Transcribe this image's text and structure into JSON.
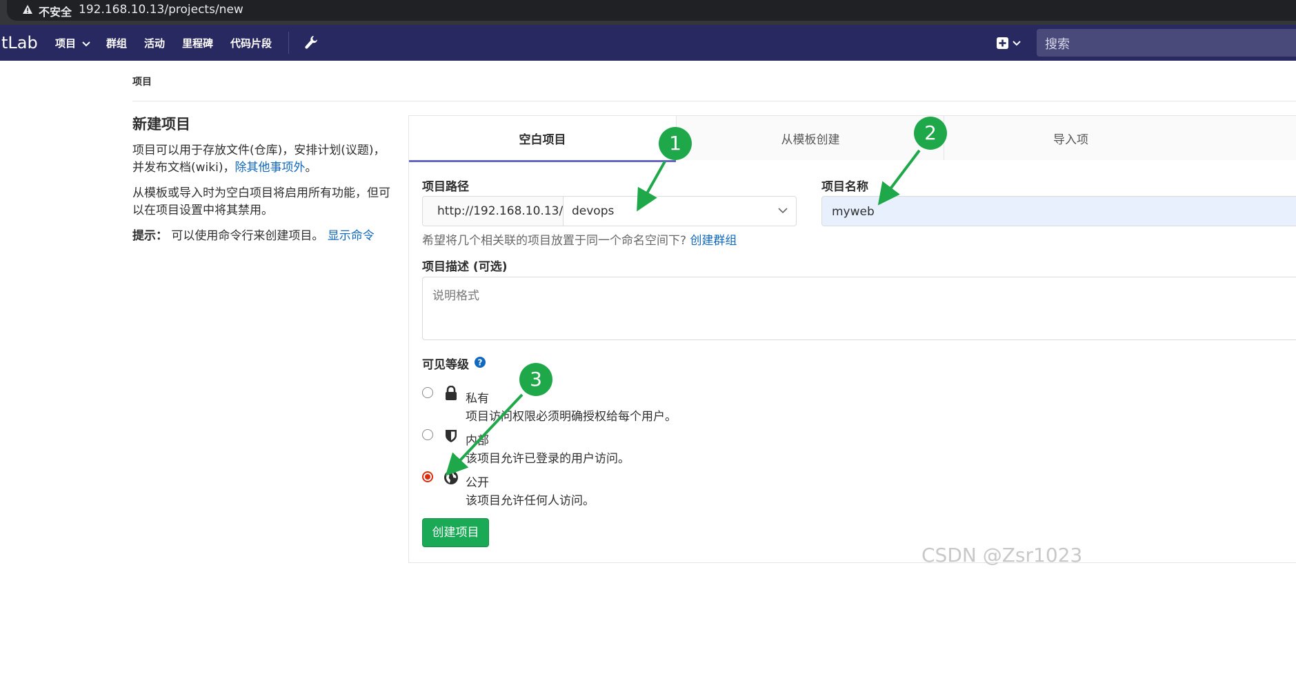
{
  "browser": {
    "insecure_label": "不安全",
    "url": "192.168.10.13/projects/new"
  },
  "nav": {
    "brand": "tLab",
    "items": [
      "项目",
      "群组",
      "活动",
      "里程碑",
      "代码片段"
    ],
    "search_placeholder": "搜索"
  },
  "breadcrumb": "项目",
  "left": {
    "title": "新建项目",
    "desc1": "项目可以用于存放文件(仓库)，安排计划(议题)，并发布文档(wiki)，",
    "desc1_link": "除其他事项外",
    "desc1_end": "。",
    "desc2": "从模板或导入时为空白项目将启用所有功能，但可以在项目设置中将其禁用。",
    "tip_label": "提示：",
    "tip_text": "可以使用命令行来创建项目。",
    "tip_link": "显示命令"
  },
  "tabs": [
    "空白项目",
    "从模板创建",
    "导入项"
  ],
  "form": {
    "path_label": "项目路径",
    "path_prefix": "http://192.168.10.13/",
    "namespace": "devops",
    "name_label": "项目名称",
    "name_value": "myweb",
    "hint_text": "希望将几个相关联的项目放置于同一个命名空间下?",
    "hint_link": "创建群组",
    "desc_label": "项目描述 (可选)",
    "desc_placeholder": "说明格式",
    "visibility_label": "可见等级",
    "visibility": [
      {
        "title": "私有",
        "desc": "项目访问权限必须明确授权给每个用户。",
        "icon": "lock-icon",
        "checked": false
      },
      {
        "title": "内部",
        "desc": "该项目允许已登录的用户访问。",
        "icon": "shield-icon",
        "checked": false
      },
      {
        "title": "公开",
        "desc": "该项目允许任何人访问。",
        "icon": "globe-icon",
        "checked": true
      }
    ],
    "create_button": "创建项目"
  },
  "annotations": [
    "1",
    "2",
    "3"
  ],
  "watermark": "CSDN @Zsr1023",
  "colors": {
    "nav_bg": "#292961",
    "accent_tab": "#6666c4",
    "link": "#1068bf",
    "create_button": "#1aaa55",
    "annotation": "#1fa84a",
    "radio_checked": "#dd2b0e"
  }
}
